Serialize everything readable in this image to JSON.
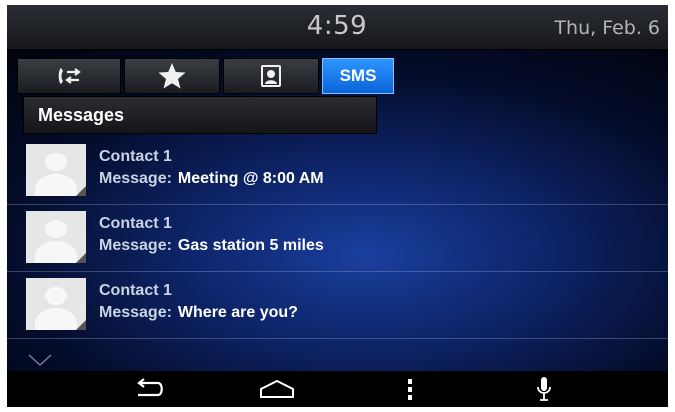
{
  "status_bar": {
    "time": "4:59",
    "date": "Thu, Feb. 6"
  },
  "tabs": [
    {
      "name": "recent-calls",
      "icon": "phone-arrows-icon",
      "active": false
    },
    {
      "name": "favorites",
      "icon": "star-icon",
      "active": false
    },
    {
      "name": "contacts",
      "icon": "contact-card-icon",
      "active": false
    },
    {
      "name": "sms",
      "label": "SMS",
      "active": true
    }
  ],
  "section": {
    "title": "Messages"
  },
  "messages": [
    {
      "contact": "Contact 1",
      "label": "Message:",
      "text": "Meeting @ 8:00 AM"
    },
    {
      "contact": "Contact 1",
      "label": "Message:",
      "text": "Gas station 5 miles"
    },
    {
      "contact": "Contact 1",
      "label": "Message:",
      "text": "Where are you?"
    }
  ],
  "nav": {
    "icons": [
      "back-icon",
      "home-icon",
      "menu-icon",
      "microphone-icon"
    ]
  },
  "colors": {
    "accent": "#1a7cf0",
    "background": "#0d2468"
  }
}
